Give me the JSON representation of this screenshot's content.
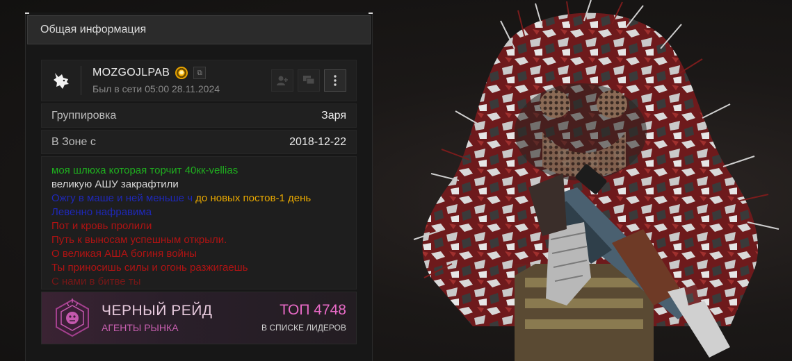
{
  "panel": {
    "title": "Общая информация"
  },
  "profile": {
    "name": "MOZGOJLPAB",
    "last_seen": "Был в сети 05:00 28.11.2024",
    "icons": [
      "wolf-icon",
      "badge-icon",
      "copy-icon",
      "add-friend-icon",
      "chat-icon",
      "more-icon"
    ]
  },
  "info_rows": [
    {
      "label": "Группировка",
      "value": "Заря"
    },
    {
      "label": "В Зоне с",
      "value": "2018-12-22"
    }
  ],
  "about": {
    "lines": [
      {
        "parts": [
          {
            "text": "моя шлюха которая торчит 40кк-vellias",
            "color": "#1fae1f"
          }
        ]
      },
      {
        "parts": [
          {
            "text": " великую АШУ закрафтили",
            "color": "#d8d8d8"
          }
        ]
      },
      {
        "parts": [
          {
            "text": "Ожгу в маше и ней меньше ч",
            "color": "#1e28b8"
          },
          {
            "text": " до новых постов-1 день",
            "color": "#e8a800"
          }
        ]
      },
      {
        "parts": [
          {
            "text": "Левенно нафравима",
            "color": "#1e28b8"
          }
        ]
      },
      {
        "parts": [
          {
            "text": "Пот и кровь пролили",
            "color": "#b01313"
          }
        ]
      },
      {
        "parts": [
          {
            "text": "Путь к выносам успешным открыли.",
            "color": "#b01313"
          }
        ]
      },
      {
        "parts": [
          {
            "text": "О великая АША богиня войны",
            "color": "#b01313"
          }
        ]
      },
      {
        "parts": [
          {
            "text": "Ты приносишь силы и огонь разжигаешь",
            "color": "#b01313"
          }
        ]
      },
      {
        "parts": [
          {
            "text": "С нами в битве ты",
            "color": "#b01313"
          }
        ]
      }
    ]
  },
  "leaderboard": {
    "clan_name": "ЧЕРНЫЙ РЕЙД",
    "clan_subtitle": "АГЕНТЫ РЫНКА",
    "rank": "ТОП 4748",
    "rank_subtitle": "В СПИСКЕ ЛИДЕРОВ",
    "accent_color": "#e86ac6"
  }
}
